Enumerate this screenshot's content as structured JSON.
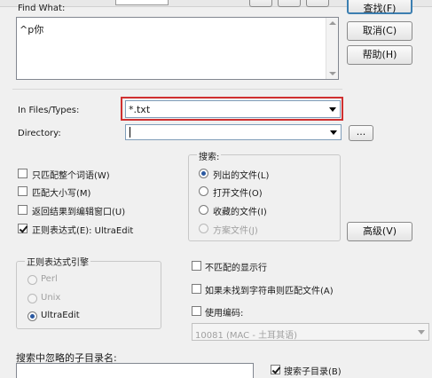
{
  "find_what": {
    "label": "Find What:",
    "value": "^p你"
  },
  "buttons": {
    "find": "查找(F)",
    "cancel": "取消(C)",
    "help": "帮助(H)",
    "advanced": "高级(V)",
    "browse": "..."
  },
  "in_files": {
    "label": "In Files/Types:",
    "value": "*.txt"
  },
  "directory": {
    "label": "Directory:",
    "value": ""
  },
  "options": [
    {
      "label": "只匹配整个词语(W)",
      "checked": false
    },
    {
      "label": "匹配大小写(M)",
      "checked": false
    },
    {
      "label": "返回结果到编辑窗口(U)",
      "checked": false
    },
    {
      "label": "正则表达式(E): UltraEdit",
      "checked": true
    }
  ],
  "search_group": {
    "title": "搜索:",
    "items": [
      {
        "label": "列出的文件(L)",
        "checked": true,
        "disabled": false
      },
      {
        "label": "打开文件(O)",
        "checked": false,
        "disabled": false
      },
      {
        "label": "收藏的文件(I)",
        "checked": false,
        "disabled": false
      },
      {
        "label": "方案文件(J)",
        "checked": false,
        "disabled": true
      }
    ]
  },
  "regex_engine": {
    "title": "正则表达式引擎",
    "items": [
      {
        "label": "Perl",
        "checked": false
      },
      {
        "label": "Unix",
        "checked": false
      },
      {
        "label": "UltraEdit",
        "checked": true
      }
    ]
  },
  "right_options": [
    {
      "label": "不匹配的显示行",
      "checked": false
    },
    {
      "label": "如果未找到字符串则匹配文件(A)",
      "checked": false
    },
    {
      "label": "使用编码:",
      "checked": false
    }
  ],
  "encoding": {
    "value": "10081 (MAC - 土耳其语)"
  },
  "ignore_subdirs": {
    "label": "搜索中忽略的子目录名:",
    "value": ""
  },
  "search_subdirs": {
    "label": "搜索子目录(B)",
    "checked": true
  },
  "colors": {
    "highlight_border": "#d03030",
    "focus_button_border": "#3c7fb1"
  }
}
